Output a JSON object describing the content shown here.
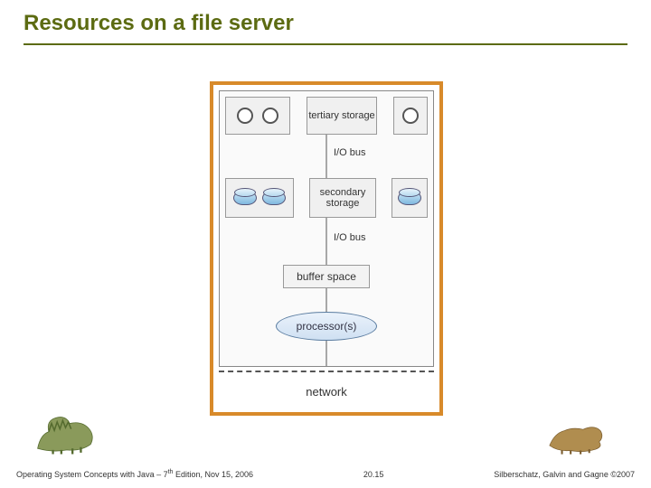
{
  "title": "Resources on a file server",
  "diagram": {
    "tertiary_label": "tertiary storage",
    "iobus1": "I/O bus",
    "secondary_label": "secondary storage",
    "iobus2": "I/O bus",
    "buffer": "buffer space",
    "processors": "processor(s)",
    "network": "network"
  },
  "footer": {
    "left_prefix": "Operating System Concepts with Java – 7",
    "left_sup": "th",
    "left_suffix": " Edition, Nov 15, 2006",
    "center": "20.15",
    "right": "Silberschatz, Galvin and Gagne ©2007"
  }
}
